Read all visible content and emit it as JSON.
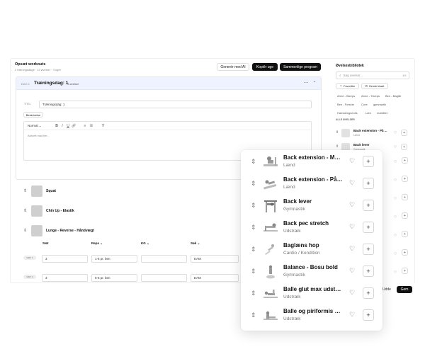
{
  "header": {
    "title": "Opsæt workouts",
    "subtitle": "2 træningsdage · 10 øvelser · 4 uger",
    "buttons": {
      "ai": "Generér med AI",
      "copy": "Kopiér uge",
      "merge": "Sammenlign program"
    }
  },
  "day": {
    "badge": "DAG 1",
    "title": "Træningsdag: 1",
    "count": "9 øvelser",
    "title_label": "TITEL",
    "title_value": "Træningsdag: 1",
    "desc_tab": "Beskrivelse",
    "editor_style": "Normal",
    "editor_placeholder": "Avitoett mad her..."
  },
  "exercises": [
    {
      "name": "Squat"
    },
    {
      "name": "Chin Up - Elastik"
    },
    {
      "name": "Lunge - Reverse - Håndvægt"
    }
  ],
  "sets_table": {
    "headers": [
      "Sæt",
      "Reps",
      "KG",
      "Søk"
    ],
    "rows": [
      {
        "badge": "SÆT 1",
        "set": "3",
        "reps": "1-6 pr. ben",
        "kg": "",
        "extra": "EAM"
      },
      {
        "badge": "SÆT 2",
        "set": "3",
        "reps": "5-6 pr. ben",
        "kg": "",
        "extra": "EAM"
      }
    ]
  },
  "library": {
    "title": "Øvelsesbibliotek",
    "search_placeholder": "Søg øvelser...",
    "search_shortcut": "⌘K",
    "tab_favorites": "Favoritter",
    "tab_custom": "Gemte bisæt",
    "chips": [
      "Arme - Biceps",
      "Arme - Triceps",
      "Ben - Baglår",
      "Ben - Forside",
      "Core",
      "gymnastik",
      "Hamstrings/rolls",
      "Læn",
      "mobilitet"
    ],
    "section": "ALLE ØVELSER",
    "rows": [
      {
        "name": "Back extension - På ...",
        "cat": "Lænd"
      },
      {
        "name": "Back lever",
        "cat": "Gymnastik"
      }
    ],
    "bottom_cancel": "Udde",
    "bottom_done": "Gem"
  },
  "popup": {
    "rows": [
      {
        "name": "Back extension - Maskine",
        "cat": "Lænd"
      },
      {
        "name": "Back extension - På bænk",
        "cat": "Lænd"
      },
      {
        "name": "Back lever",
        "cat": "Gymnastik"
      },
      {
        "name": "Back pec stretch",
        "cat": "Udstræk"
      },
      {
        "name": "Baglæns hop",
        "cat": "Cardio / Kondition"
      },
      {
        "name": "Balance - Bosu bold",
        "cat": "Gymnastik"
      },
      {
        "name": "Balle glut max udstrækning",
        "cat": "Udstræk"
      },
      {
        "name": "Balle og piriformis stretch",
        "cat": "Udstræk"
      }
    ]
  },
  "icons": {
    "drag": "drag-handle-icon",
    "heart": "heart-icon",
    "plus": "plus-icon",
    "search": "search-icon",
    "chevron": "chevron-down-icon"
  },
  "colors": {
    "primary": "#111111",
    "accent": "#2f6bff",
    "border": "#e3e3e3"
  }
}
